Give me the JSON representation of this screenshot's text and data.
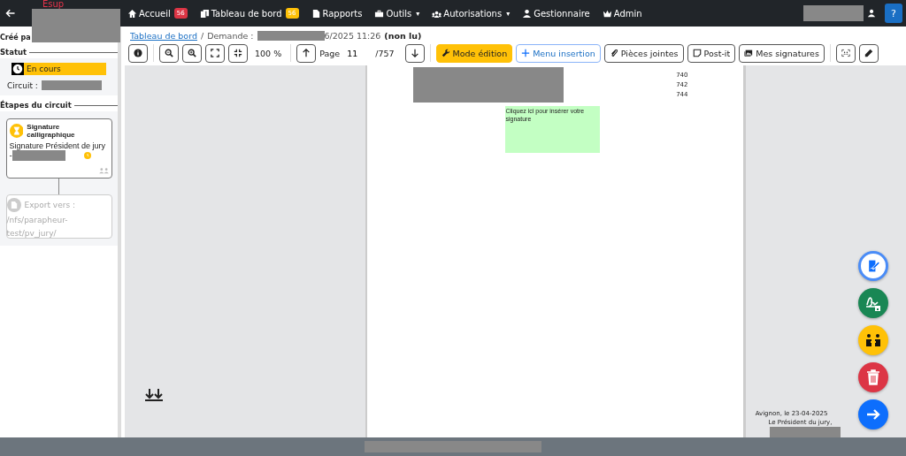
{
  "navbar": {
    "brand": "Esup",
    "items": [
      {
        "label": "Accueil",
        "badge": "56",
        "color": "#dc3545"
      },
      {
        "label": "Tableau de bord",
        "badge": "56",
        "color": "#ffc107"
      },
      {
        "label": "Rapports"
      },
      {
        "label": "Outils",
        "caret": "▾"
      },
      {
        "label": "Autorisations",
        "caret": "▾"
      },
      {
        "label": "Gestionnaire"
      },
      {
        "label": "Admin"
      }
    ],
    "help": "?"
  },
  "sidebar": {
    "created_by": "Créé pa",
    "status_heading": "Statut",
    "status": "En cours",
    "circuit_label": "Circuit :",
    "steps_heading": "Étapes du circuit",
    "steps": [
      {
        "kind": "signature",
        "title": "Signature calligraphique",
        "text": "Signature Président de jury",
        "prefix": "-",
        "disabled": false
      },
      {
        "kind": "export",
        "title": "Export vers :",
        "text": "/nfs/parapheur-test/pv_jury/",
        "disabled": true
      }
    ]
  },
  "breadcrumb": {
    "link": "Tableau de bord",
    "separator": "/",
    "label": "Demande :",
    "date": "6/2025 11:26",
    "status": "(non lu)"
  },
  "toolbar": {
    "zoom": "100 %",
    "page_label": "Page",
    "page": "11",
    "page_total": "/757",
    "buttons": [
      {
        "label": "Mode édition",
        "kind": "warning"
      },
      {
        "label": "Menu insertion",
        "kind": "primary-outline"
      },
      {
        "label": "Pièces jointes",
        "kind": "outline"
      },
      {
        "label": "Post-it",
        "kind": "outline"
      },
      {
        "label": "Mes signatures",
        "kind": "outline"
      }
    ]
  },
  "document": {
    "numbers": [
      "740",
      "742",
      "744"
    ],
    "signature_zone": "Cliquez ici pour insérer votre signature",
    "place_date": "Avignon, le 23-04-2025",
    "signatory": "Le Président du jury,"
  },
  "actions": [
    {
      "color": "#ffffff"
    },
    {
      "color": "#198754"
    },
    {
      "color": "#ffc107"
    },
    {
      "color": "#dc3545"
    },
    {
      "color": "#0d6efd"
    }
  ]
}
